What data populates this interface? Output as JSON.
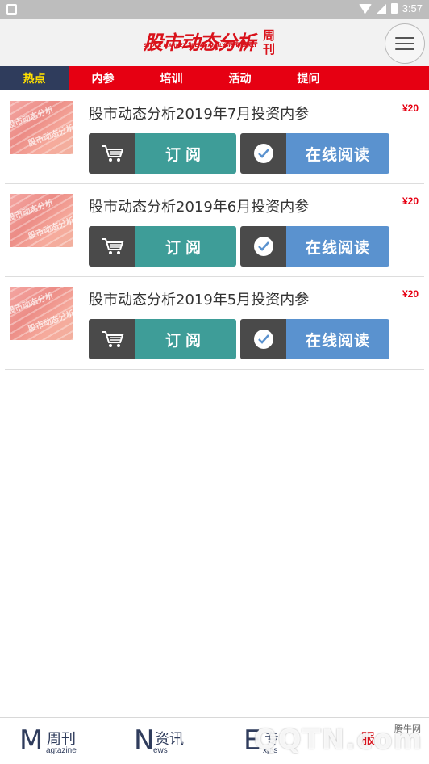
{
  "status_bar": {
    "time": "3:57"
  },
  "header": {
    "logo_main": "股市动态分析",
    "logo_sub": "STOCK MARKET TREND ANALYSIS WEEKLY",
    "logo_tag": "证券投资者 投资理财专",
    "logo_weekly_1": "周",
    "logo_weekly_2": "刊"
  },
  "tabs": [
    {
      "label": "热点",
      "active": true
    },
    {
      "label": "内参",
      "active": false
    },
    {
      "label": "培训",
      "active": false
    },
    {
      "label": "活动",
      "active": false
    },
    {
      "label": "提问",
      "active": false
    }
  ],
  "items": [
    {
      "title": "股市动态分析2019年7月投资内参",
      "price": "¥20",
      "subscribe_label": "订阅",
      "read_label": "在线阅读"
    },
    {
      "title": "股市动态分析2019年6月投资内参",
      "price": "¥20",
      "subscribe_label": "订阅",
      "read_label": "在线阅读"
    },
    {
      "title": "股市动态分析2019年5月投资内参",
      "price": "¥20",
      "subscribe_label": "订阅",
      "read_label": "在线阅读"
    }
  ],
  "bottom_nav": [
    {
      "big": "M",
      "cn": "周刊",
      "en": "agtazine"
    },
    {
      "big": "N",
      "cn": "资讯",
      "en": "ews"
    },
    {
      "big": "E",
      "cn": "专",
      "en": "xp  s"
    },
    {
      "big": "",
      "cn": "服",
      "en": ""
    }
  ],
  "watermark": {
    "text": "QQTN.com",
    "small": "腾牛网"
  },
  "colors": {
    "brand_red": "#e60012",
    "tab_active_bg": "#2f3c5c",
    "subscribe_bg": "#3e9d98",
    "read_bg": "#5a92cf"
  }
}
